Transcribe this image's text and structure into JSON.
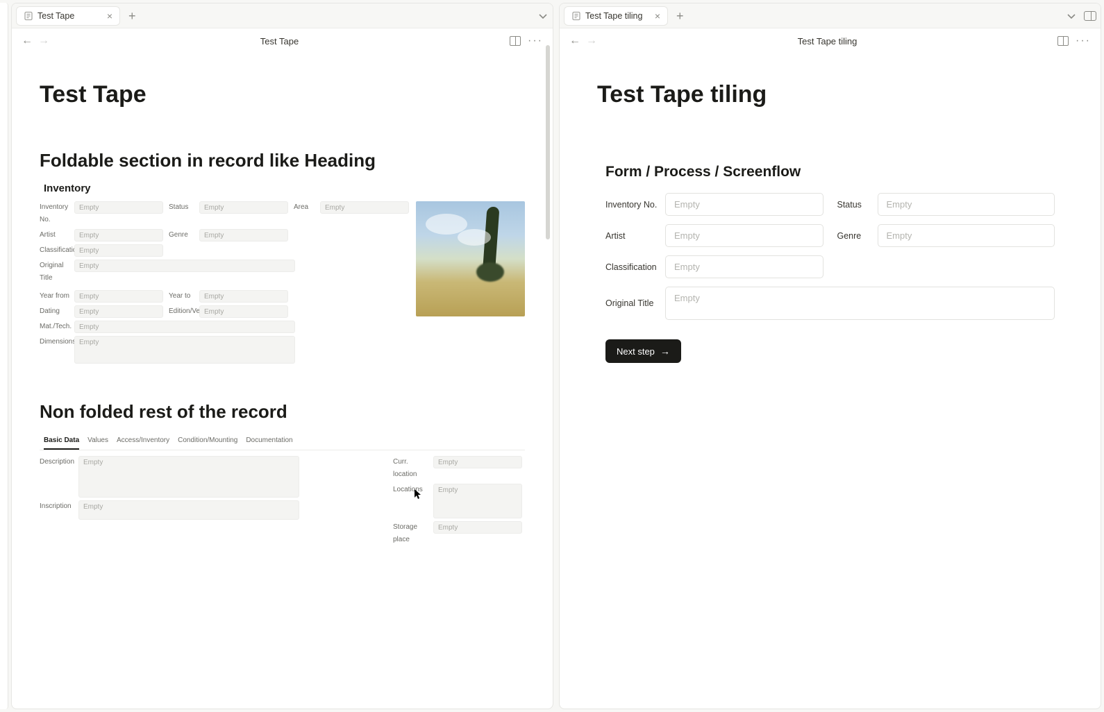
{
  "leftPane": {
    "tab": {
      "title": "Test Tape"
    },
    "breadcrumb": "Test Tape",
    "pageTitle": "Test Tape",
    "section1Heading": "Foldable section in record like Heading",
    "inventoryHeading": "Inventory",
    "inv": {
      "labels": {
        "inventoryNo": "Inventory No.",
        "status": "Status",
        "area": "Area",
        "artist": "Artist",
        "genre": "Genre",
        "classification": "Classification",
        "originalTitle": "Original Title",
        "yearFrom": "Year from",
        "yearTo": "Year to",
        "dating": "Dating",
        "editionVers": "Edition/Vers.",
        "matTech": "Mat./Tech.",
        "dimensions": "Dimensions"
      },
      "placeholder": "Empty"
    },
    "section2Heading": "Non folded rest of the record",
    "recordTabs": [
      "Basic Data",
      "Values",
      "Access/Inventory",
      "Condition/Mounting",
      "Documentation"
    ],
    "recordTabActive": 0,
    "basic": {
      "labels": {
        "description": "Description",
        "inscription": "Inscription",
        "currLocation": "Curr. location",
        "locations": "Locations",
        "storagePlace": "Storage place"
      },
      "placeholder": "Empty"
    }
  },
  "rightPane": {
    "tab": {
      "title": "Test Tape tiling"
    },
    "breadcrumb": "Test Tape tiling",
    "pageTitle": "Test Tape tiling",
    "formHeading": "Form / Process / Screenflow",
    "form": {
      "labels": {
        "inventoryNo": "Inventory No.",
        "status": "Status",
        "artist": "Artist",
        "genre": "Genre",
        "classification": "Classification",
        "originalTitle": "Original Title"
      },
      "placeholder": "Empty",
      "nextButton": "Next step"
    }
  }
}
